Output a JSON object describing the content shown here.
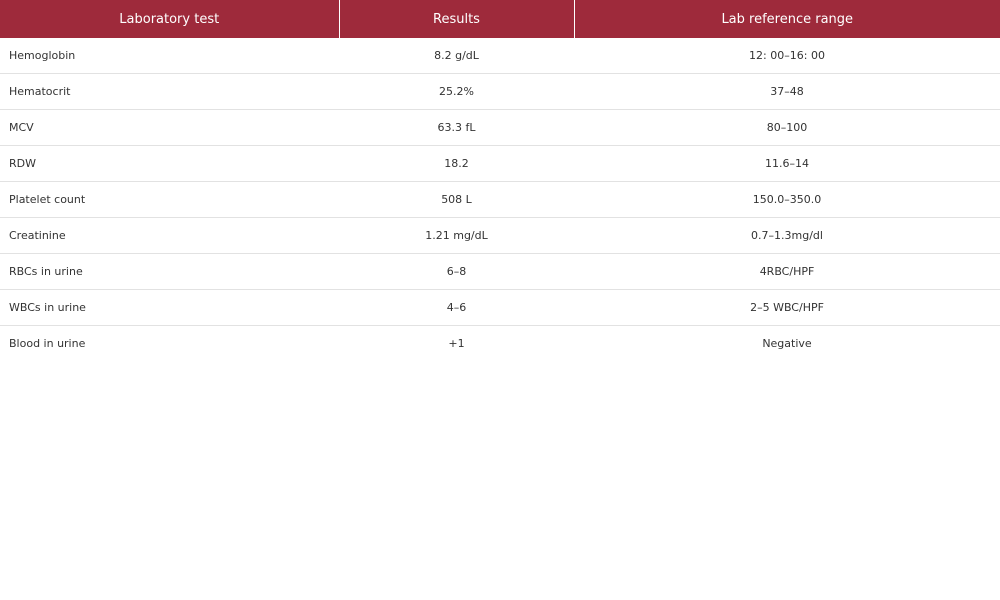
{
  "table": {
    "headers": [
      "Laboratory test",
      "Results",
      "Lab reference range"
    ],
    "rows": [
      {
        "test": "Hemoglobin",
        "result": "8.2 g/dL",
        "range": "12: 00–16: 00"
      },
      {
        "test": "Hematocrit",
        "result": "25.2%",
        "range": "37–48"
      },
      {
        "test": "MCV",
        "result": "63.3 fL",
        "range": "80–100"
      },
      {
        "test": "RDW",
        "result": "18.2",
        "range": "11.6–14"
      },
      {
        "test": "Platelet count",
        "result": "508 L",
        "range": "150.0–350.0"
      },
      {
        "test": "Creatinine",
        "result": "1.21 mg/dL",
        "range": "0.7–1.3mg/dl"
      },
      {
        "test": "RBCs in urine",
        "result": "6–8",
        "range": "4RBC/HPF"
      },
      {
        "test": "WBCs in urine",
        "result": "4–6",
        "range": "2–5 WBC/HPF"
      },
      {
        "test": "Blood in urine",
        "result": "+1",
        "range": "Negative"
      }
    ]
  }
}
